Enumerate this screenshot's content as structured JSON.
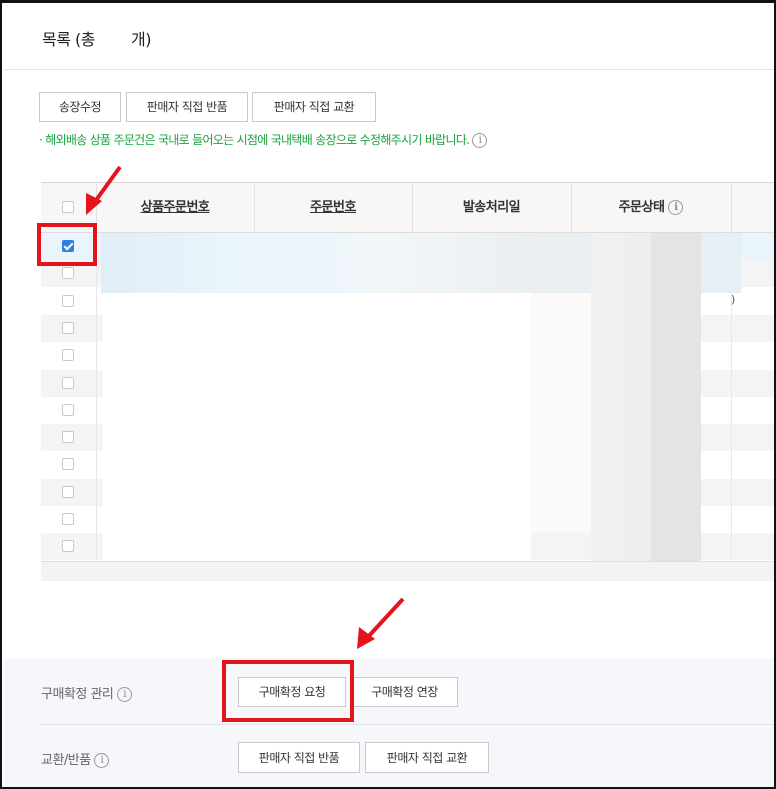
{
  "header": {
    "title_prefix": "목록 (총",
    "title_suffix": "개)"
  },
  "toolbar": {
    "buttons": [
      {
        "label": "송장수정"
      },
      {
        "label": "판매자 직접 반품"
      },
      {
        "label": "판매자 직접 교환"
      }
    ],
    "notice": "· 해외배송 상품 주문건은 국내로 들어오는 시점에 국내택배 송장으로 수정해주시기 바랍니다.",
    "info_glyph": "i"
  },
  "table": {
    "columns": [
      {
        "label": "상품주문번호",
        "sortable": true
      },
      {
        "label": "주문번호",
        "sortable": true
      },
      {
        "label": "발송처리일",
        "sortable": false
      },
      {
        "label": "주문상태",
        "sortable": false
      }
    ],
    "row_count": 12,
    "checked_rows": [
      0
    ],
    "fragment_text": ")"
  },
  "bottom": {
    "purchase_confirm": {
      "label": "구매확정 관리",
      "buttons": [
        {
          "label": "구매확정 요청"
        },
        {
          "label": "구매확정 연장"
        }
      ]
    },
    "exchange_return": {
      "label": "교환/반품",
      "buttons": [
        {
          "label": "판매자 직접 반품"
        },
        {
          "label": "판매자 직접 교환"
        }
      ]
    }
  },
  "colors": {
    "notice": "#1aa33b",
    "checkbox_checked": "#2f7fe0",
    "annotation": "#e3141b"
  }
}
